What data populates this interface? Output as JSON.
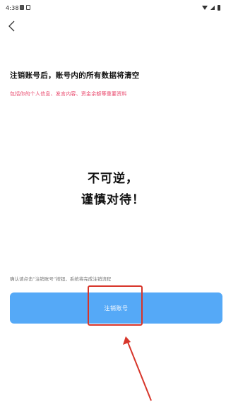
{
  "status_bar": {
    "time": "4:38",
    "icons": [
      "notification-icon",
      "notification-icon",
      "wifi-icon",
      "signal-icon",
      "battery-icon"
    ]
  },
  "header": {
    "back_icon": "chevron-left-icon"
  },
  "main": {
    "headline": "注销账号后，账号内的所有数据将清空",
    "warning": "包括你的个人信息、发言内容、资金余额等重要资料",
    "center_line_1": "不可逆，",
    "center_line_2": "谨慎对待！",
    "confirm_note": "确认请点击“注销账号”按钮，系统将完成注销流程",
    "button_label": "注销账号"
  },
  "colors": {
    "button": "#55a9f7",
    "warning": "#e8456a",
    "annotation": "#d7352a"
  }
}
